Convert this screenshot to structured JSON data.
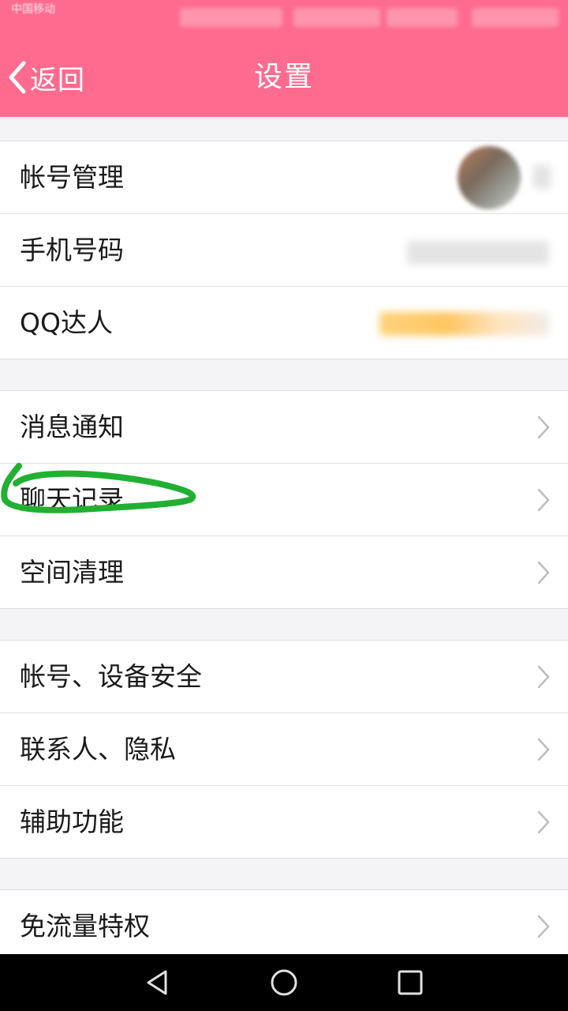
{
  "status_bar": {
    "carrier": "中国移动"
  },
  "header": {
    "back_label": "返回",
    "title": "设置"
  },
  "groups": [
    {
      "items": [
        {
          "label": "帐号管理"
        },
        {
          "label": "手机号码"
        },
        {
          "label": "QQ达人"
        }
      ]
    },
    {
      "items": [
        {
          "label": "消息通知"
        },
        {
          "label": "聊天记录"
        },
        {
          "label": "空间清理"
        }
      ]
    },
    {
      "items": [
        {
          "label": "帐号、设备安全"
        },
        {
          "label": "联系人、隐私"
        },
        {
          "label": "辅助功能"
        }
      ]
    },
    {
      "items": [
        {
          "label": "免流量特权"
        }
      ]
    }
  ],
  "colors": {
    "header_bg": "#fe6b8e",
    "page_bg": "#f4f4f6",
    "highlight_stroke": "#22b033"
  },
  "icons": {
    "back": "chevron-left-icon",
    "row_arrow": "chevron-right-icon",
    "nav_back": "triangle-back-icon",
    "nav_home": "circle-home-icon",
    "nav_recents": "square-recents-icon"
  }
}
